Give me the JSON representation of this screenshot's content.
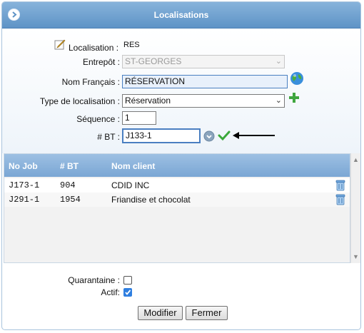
{
  "dialog": {
    "title": "Localisations"
  },
  "form": {
    "localisation_label": "Localisation :",
    "localisation_value": "RES",
    "entrepot_label": "Entrepôt :",
    "entrepot_value": "ST-GEORGES",
    "nom_label": "Nom Français :",
    "nom_value": "RÉSERVATION",
    "type_label": "Type de localisation :",
    "type_value": "Réservation",
    "sequence_label": "Séquence :",
    "sequence_value": "1",
    "bt_label": "# BT :",
    "bt_value": "J133-1"
  },
  "grid": {
    "columns": [
      "No Job",
      "# BT",
      "Nom client"
    ],
    "rows": [
      {
        "job": "J173-1",
        "bt": "904",
        "client": "CDID INC"
      },
      {
        "job": "J291-1",
        "bt": "1954",
        "client": "Friandise et chocolat"
      }
    ]
  },
  "options": {
    "quarantaine_label": "Quarantaine :",
    "quarantaine_checked": false,
    "actif_label": "Actif:",
    "actif_checked": true
  },
  "buttons": {
    "modifier": "Modifier",
    "fermer": "Fermer"
  },
  "colors": {
    "title_bar": "#6f9fd0",
    "grid_header": "#8bb3dc",
    "add_icon": "#3fa63f",
    "check_icon": "#3aa83a"
  },
  "icons": [
    "edit-icon",
    "globe-icon",
    "add-icon",
    "dropdown-circle-icon",
    "check-icon",
    "arrow-left-icon",
    "trash-icon"
  ]
}
